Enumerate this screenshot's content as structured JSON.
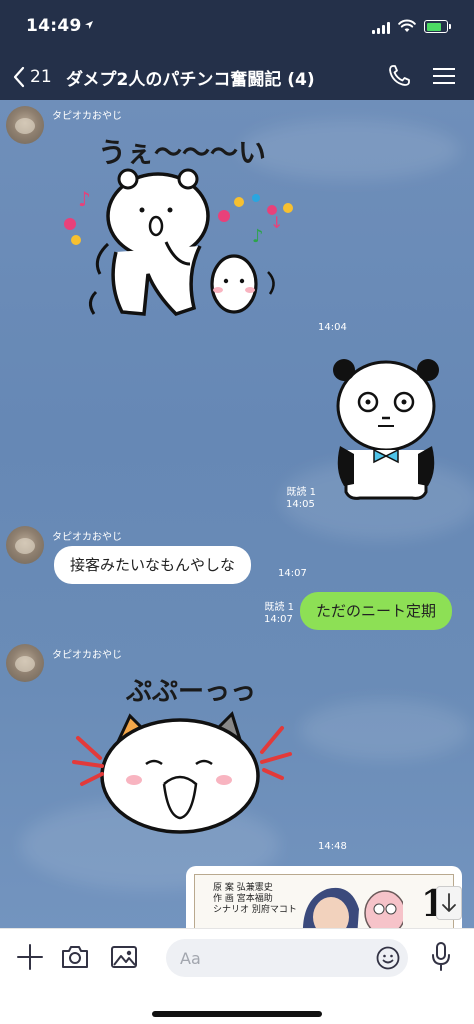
{
  "status_bar": {
    "time": "14:49",
    "battery_level": 0.8,
    "battery_color": "#4cd964"
  },
  "header": {
    "back_count": "21",
    "title": "ダメプ2人のパチンコ奮闘記 (4)",
    "background": "#243049"
  },
  "messages": [
    {
      "type": "sticker",
      "direction": "in",
      "sender": "タピオカおやじ",
      "sticker_text": "うぇ〜〜〜い",
      "time": "14:04"
    },
    {
      "type": "sticker",
      "direction": "out",
      "read": "既読 1",
      "time": "14:05"
    },
    {
      "type": "text",
      "direction": "in",
      "sender": "タピオカおやじ",
      "text": "接客みたいなもんやしな",
      "time": "14:07"
    },
    {
      "type": "text",
      "direction": "out",
      "read": "既読 1",
      "text": "ただのニート定期",
      "time": "14:07"
    },
    {
      "type": "sticker",
      "direction": "in",
      "sender": "タピオカおやじ",
      "sticker_text": "ぷぷーっっ",
      "time": "14:48"
    },
    {
      "type": "image",
      "direction": "out",
      "manga_credits": [
        "原 案 弘兼憲史",
        "作 画 宮本福助",
        "シナリオ 別府マコト"
      ],
      "volume": "1"
    }
  ],
  "colors": {
    "bubble_out": "#8de055",
    "bubble_in": "#ffffff",
    "chat_bg": "#6a8cb7"
  },
  "input_bar": {
    "placeholder": "Aa"
  },
  "icons": [
    "location-arrow-icon",
    "signal-icon",
    "wifi-icon",
    "battery-icon",
    "back-chevron-icon",
    "phone-icon",
    "menu-icon",
    "plus-icon",
    "camera-icon",
    "image-icon",
    "emoji-icon",
    "mic-icon",
    "scroll-down-icon"
  ]
}
